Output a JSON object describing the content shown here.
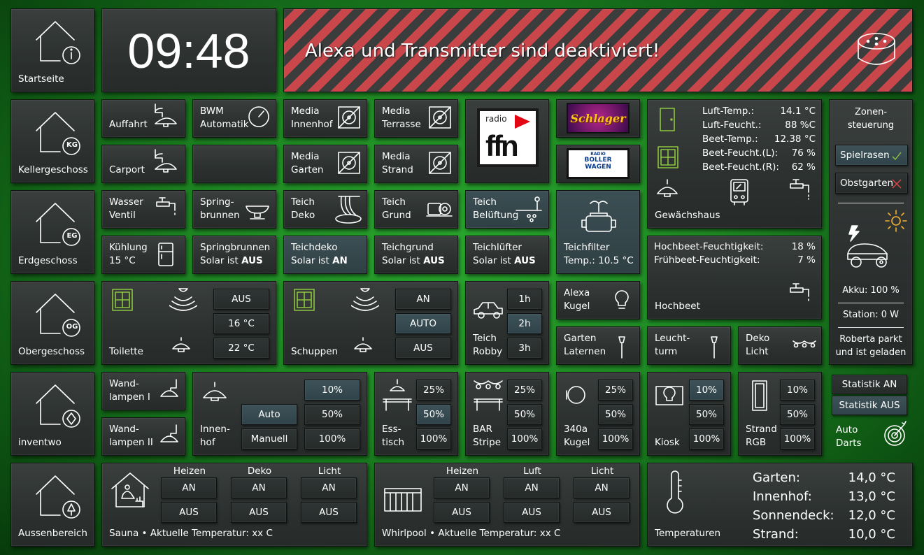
{
  "nav": {
    "start": "Startseite",
    "keller": "Kellergeschoss",
    "erd": "Erdgeschoss",
    "ober": "Obergeschoss",
    "inventwo": "inventwo",
    "aussen": "Aussenbereich",
    "kg": "KG",
    "eg": "EG",
    "og": "OG"
  },
  "clock": "09:48",
  "alert": {
    "text": "Alexa und Transmitter sind deaktiviert!",
    "colors": {
      "stripe_red": "#c9474b",
      "stripe_dark": "#3a3d3c"
    }
  },
  "kg": {
    "auffahrt": "Auffahrt",
    "carport": "Carport",
    "bwm": [
      "BWM",
      "Automatik"
    ],
    "media_innenhof": [
      "Media",
      "Innenhof"
    ],
    "media_garten": [
      "Media",
      "Garten"
    ],
    "media_terrasse": [
      "Media",
      "Terrasse"
    ],
    "media_strand": [
      "Media",
      "Strand"
    ],
    "radio_small": "radio",
    "radio_big": "ffn",
    "schlager": "Schlager",
    "boller": [
      "RADIO",
      "BOLLER",
      "WAGEN"
    ]
  },
  "greenhouse": {
    "rows": [
      {
        "k": "Luft-Temp.:",
        "v": "14.1 °C"
      },
      {
        "k": "Luft-Feucht.:",
        "v": "88 %C"
      },
      {
        "k": "Beet-Temp.:",
        "v": "12.38 °C"
      },
      {
        "k": "Beet-Feucht.(L):",
        "v": "76 %"
      },
      {
        "k": "Beet-Feucht.(R):",
        "v": "62 %"
      }
    ],
    "label": "Gewächshaus"
  },
  "zones": {
    "title": [
      "Zonen-",
      "steuerung"
    ],
    "spielrasen": "Spielrasen",
    "obstgarten": "Obstgarten",
    "akku": "Akku: 100 %",
    "station": "Station: 0 W",
    "status": [
      "Roberta parkt",
      "und ist geladen"
    ]
  },
  "eg": {
    "wasser": [
      "Wasser",
      "Ventil"
    ],
    "spring": [
      "Spring-",
      "brunnen"
    ],
    "teich_deko": [
      "Teich",
      "Deko"
    ],
    "teich_grund": [
      "Teich",
      "Grund"
    ],
    "teich_bel": [
      "Teich",
      "Belüftung"
    ],
    "teichfilter": [
      "Teichfilter",
      "Temp.: 10.5 °C"
    ],
    "kuehlung": [
      "Kühlung",
      "15 °C"
    ],
    "spring_solar": [
      "Springbrunnen",
      "Solar ist ",
      "AUS"
    ],
    "teichdeko_solar": [
      "Teichdeko",
      "Solar ist ",
      "AN"
    ],
    "teichgrund_solar": [
      "Teichgrund",
      "Solar ist ",
      "AUS"
    ],
    "teichluefter_solar": [
      "Teichlüfter",
      "Solar ist ",
      "AUS"
    ]
  },
  "hochbeet": {
    "rows": [
      {
        "k": "Hochbeet-Feuchtigkeit:",
        "v": "18 %"
      },
      {
        "k": "Frühbeet-Feuchtigkeit:",
        "v": "7 %"
      }
    ],
    "label": "Hochbeet"
  },
  "og": {
    "toilette": "Toilette",
    "toilette_btns": [
      "AUS",
      "16 °C",
      "22 °C"
    ],
    "schuppen": "Schuppen",
    "schuppen_btns": [
      "AN",
      "AUTO",
      "AUS"
    ],
    "robby": [
      "Teich",
      "Robby"
    ],
    "robby_btns": [
      "1h",
      "2h",
      "3h"
    ],
    "alexa": [
      "Alexa",
      "Kugel"
    ],
    "laternen": [
      "Garten",
      "Laternen"
    ],
    "leuchtturm": [
      "Leucht-",
      "turm"
    ],
    "deko": [
      "Deko",
      "Licht"
    ]
  },
  "inv": {
    "wand1": [
      "Wand-",
      "lampen I"
    ],
    "wand2": [
      "Wand-",
      "lampen II"
    ],
    "innenhof": [
      "Innen-",
      "hof"
    ],
    "auto": "Auto",
    "manuell": "Manuell",
    "p10": "10%",
    "p25": "25%",
    "p50": "50%",
    "p100": "100%",
    "esstisch": [
      "Ess-",
      "tisch"
    ],
    "bar": [
      "BAR",
      "Stripe"
    ],
    "kugel": [
      "340a",
      "Kugel"
    ],
    "kiosk": "Kiosk",
    "strand": [
      "Strand",
      "RGB"
    ],
    "stat_an": "Statistik AN",
    "stat_aus": "Statistik AUS",
    "darts": [
      "Auto",
      "Darts"
    ]
  },
  "outdoor": {
    "heizen": "Heizen",
    "deko": "Deko",
    "licht": "Licht",
    "luft": "Luft",
    "an": "AN",
    "aus": "AUS",
    "sauna": "Sauna • Aktuelle Temperatur: xx C",
    "whirlpool": "Whirlpool • Aktuelle Temperatur: xx C",
    "temp_label": "Temperaturen",
    "temps": [
      {
        "k": "Garten:",
        "v": "14,0 °C"
      },
      {
        "k": "Innenhof:",
        "v": "13,0 °C"
      },
      {
        "k": "Sonnendeck:",
        "v": "12,0 °C"
      },
      {
        "k": "Strand:",
        "v": "10,0 °C"
      }
    ]
  }
}
